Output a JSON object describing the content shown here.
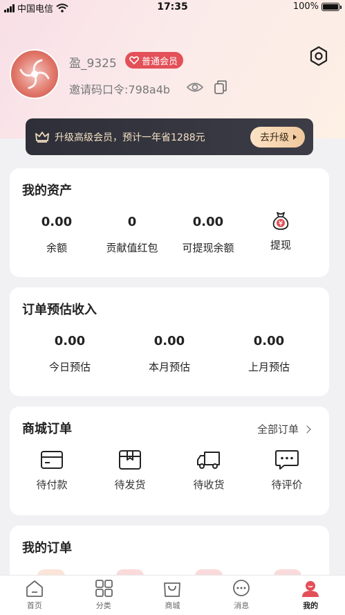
{
  "status_bar": {
    "carrier": "中国电信",
    "time": "17:35",
    "battery": "100%"
  },
  "profile": {
    "username": "盈_9325",
    "member_level": "普通会员",
    "invite_code": "邀请码口令:798a4b"
  },
  "upgrade": {
    "text": "升级高级会员，预计一年省1288元",
    "button": "去升级"
  },
  "assets": {
    "title": "我的资产",
    "items": [
      {
        "value": "0.00",
        "label": "余额"
      },
      {
        "value": "0",
        "label": "贡献值红包"
      },
      {
        "value": "0.00",
        "label": "可提现余额"
      },
      {
        "label": "提现"
      }
    ]
  },
  "estimate": {
    "title": "订单预估收入",
    "items": [
      {
        "value": "0.00",
        "label": "今日预估"
      },
      {
        "value": "0.00",
        "label": "本月预估"
      },
      {
        "value": "0.00",
        "label": "上月预估"
      }
    ]
  },
  "mall_orders": {
    "title": "商城订单",
    "all_link": "全部订单",
    "items": [
      {
        "label": "待付款"
      },
      {
        "label": "待发货"
      },
      {
        "label": "待收货"
      },
      {
        "label": "待评价"
      }
    ]
  },
  "my_orders": {
    "title": "我的订单"
  },
  "tabbar": {
    "items": [
      {
        "label": "首页"
      },
      {
        "label": "分类"
      },
      {
        "label": "商城"
      },
      {
        "label": "消息"
      },
      {
        "label": "我的"
      }
    ]
  },
  "colors": {
    "accent": "#e35058",
    "banner_bg": "#2e2f38",
    "banner_text": "#f5e1c4"
  }
}
